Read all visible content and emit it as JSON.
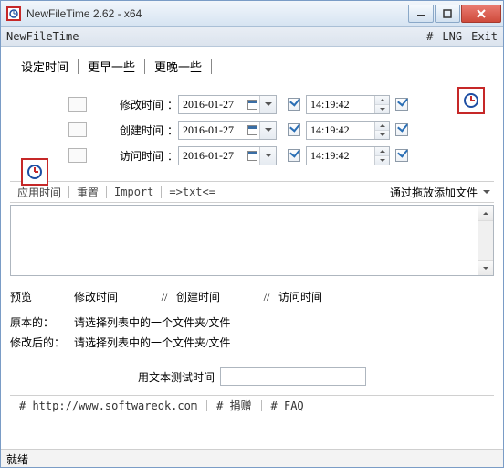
{
  "title": "NewFileTime 2.62 - x64",
  "menubar": {
    "left": "NewFileTime",
    "hash": "#",
    "lng": "LNG",
    "exit": "Exit"
  },
  "tabs": {
    "set": "设定时间",
    "earlier": "更早一些",
    "later": "更晚一些"
  },
  "rows": {
    "modify": {
      "label": "修改时间",
      "date": "2016-01-27",
      "time": "14:19:42"
    },
    "create": {
      "label": "创建时间",
      "date": "2016-01-27",
      "time": "14:19:42"
    },
    "access": {
      "label": "访问时间",
      "date": "2016-01-27",
      "time": "14:19:42"
    }
  },
  "toolbar": {
    "apply": "应用时间",
    "reset": "重置",
    "import": "Import",
    "txt": "=>txt<=",
    "dragadd": "通过拖放添加文件"
  },
  "preview": {
    "header": {
      "c1": "预览",
      "modify": "修改时间",
      "create": "创建时间",
      "access": "访问时间",
      "sep": "//"
    },
    "orig_label": "原本的",
    "after_label": "修改后的",
    "orig_msg": "请选择列表中的一个文件夹/文件",
    "after_msg": "请选择列表中的一个文件夹/文件"
  },
  "testlabel": "用文本测试时间",
  "footer": {
    "url": "# http://www.softwareok.com",
    "donate": "# 捐赠",
    "faq": "# FAQ"
  },
  "status": "就绪",
  "colon": "："
}
